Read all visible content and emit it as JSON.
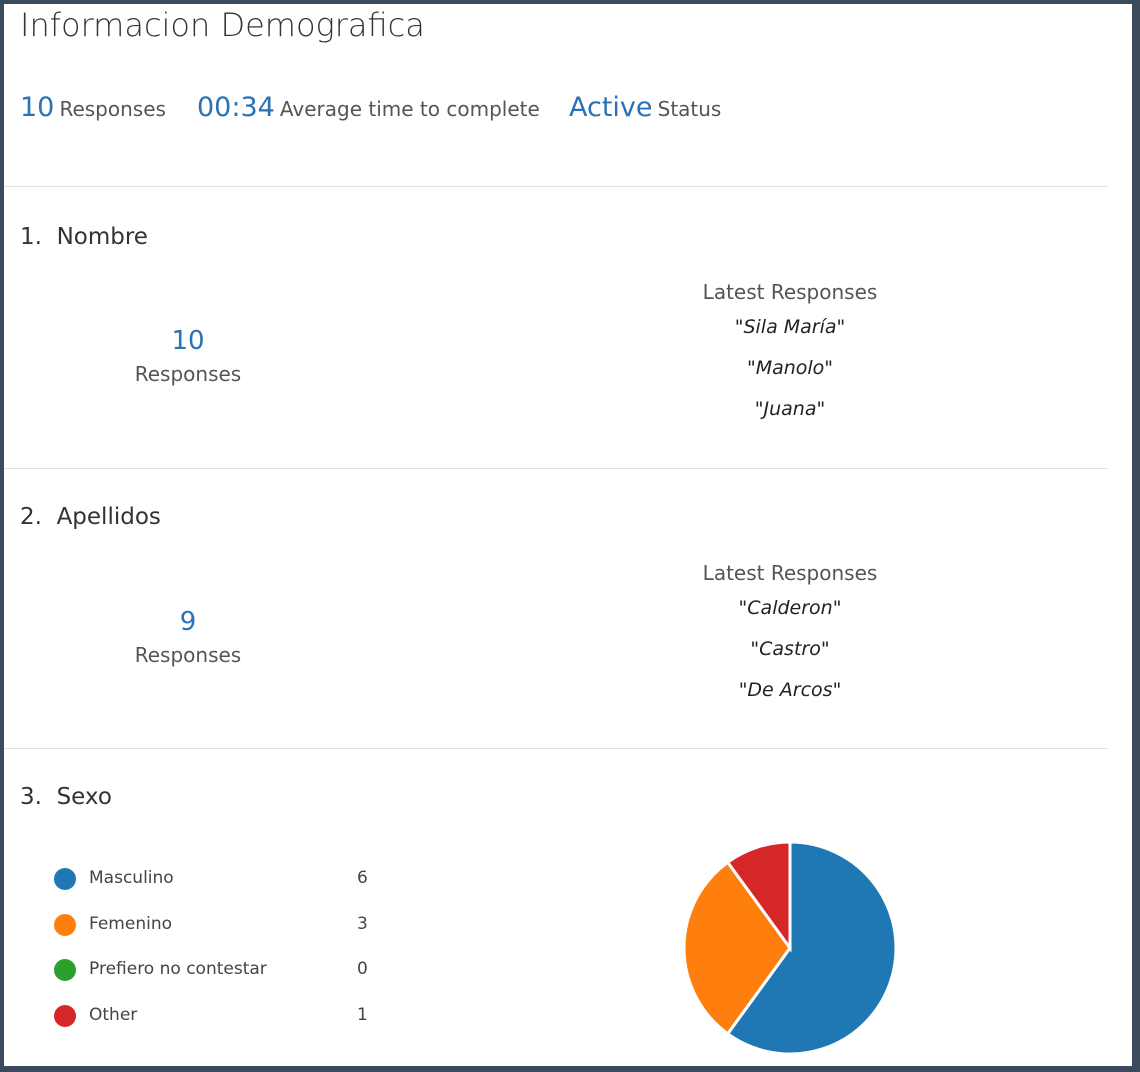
{
  "survey": {
    "title": "Informacion Demografica",
    "stats": {
      "responses_value": "10",
      "responses_label": "Responses",
      "time_value": "00:34",
      "time_label": "Average time to complete",
      "status_value": "Active",
      "status_label": "Status"
    }
  },
  "questions": [
    {
      "number": "1.",
      "title": "Nombre",
      "count": "10",
      "count_label": "Responses",
      "latest_heading": "Latest Responses",
      "latest": [
        "\"Sila María\"",
        "\"Manolo\"",
        "\"Juana\""
      ]
    },
    {
      "number": "2.",
      "title": "Apellidos",
      "count": "9",
      "count_label": "Responses",
      "latest_heading": "Latest Responses",
      "latest": [
        "\"Calderon\"",
        "\"Castro\"",
        "\"De Arcos\""
      ]
    },
    {
      "number": "3.",
      "title": "Sexo"
    }
  ],
  "chart_data": {
    "type": "pie",
    "categories": [
      "Masculino",
      "Femenino",
      "Prefiero no contestar",
      "Other"
    ],
    "values": [
      6,
      3,
      0,
      1
    ],
    "colors": [
      "#1f77b4",
      "#ff7f0e",
      "#2ca02c",
      "#d62728"
    ],
    "legend": "left"
  }
}
